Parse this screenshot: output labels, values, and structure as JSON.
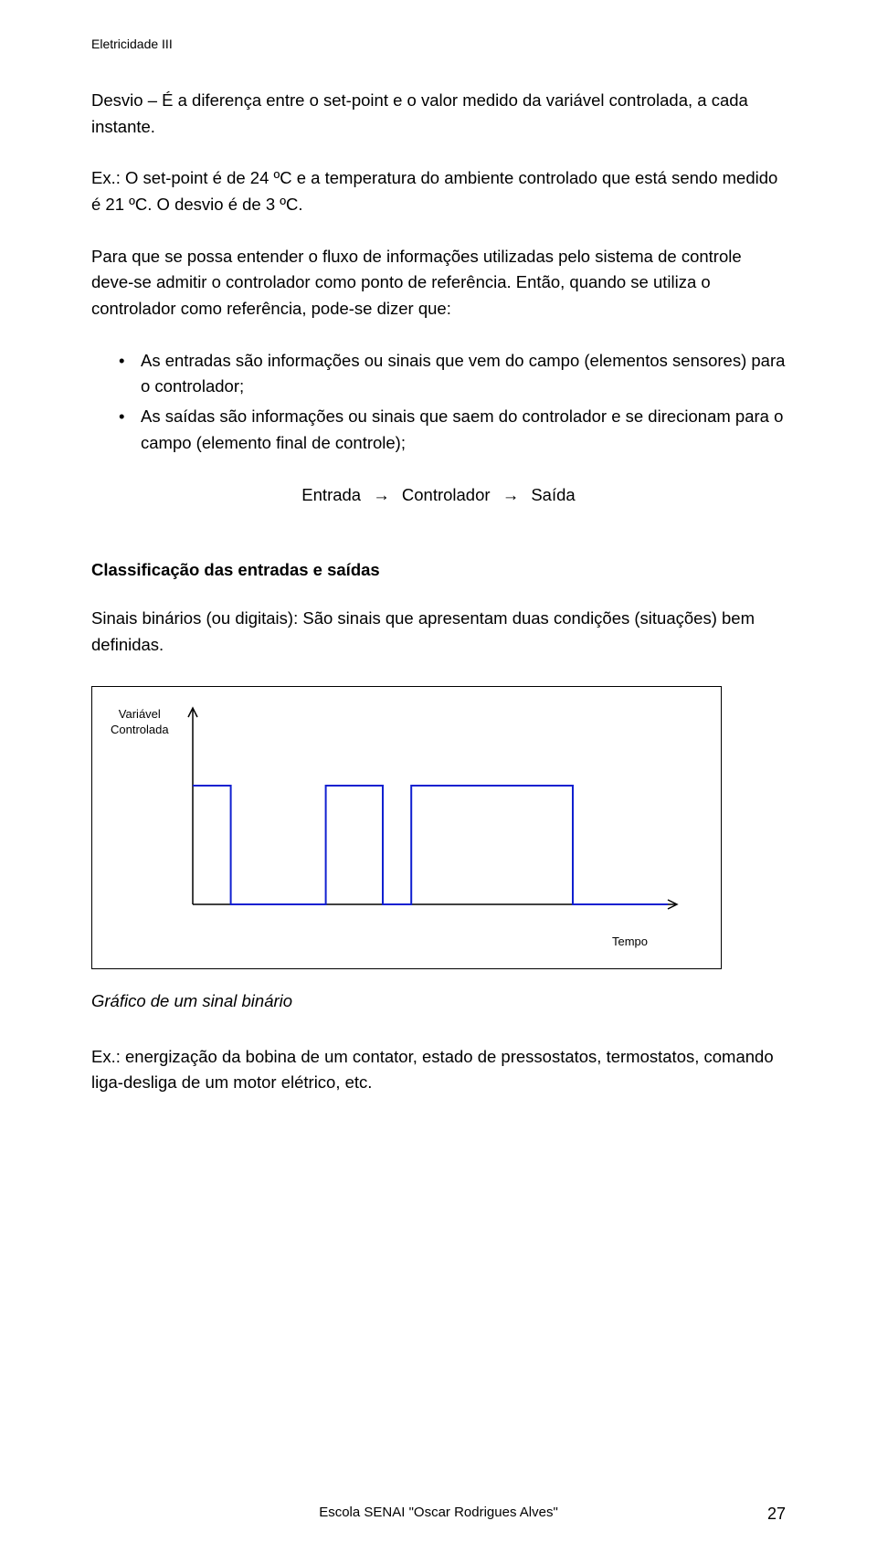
{
  "header": "Eletricidade III",
  "p1": "Desvio – É a diferença entre o set-point e o valor medido da variável controlada, a cada instante.",
  "p2": "Ex.: O set-point é de 24 ºC e a temperatura do ambiente controlado que está sendo medido é 21 ºC. O desvio é de 3 ºC.",
  "p3": "Para que se possa entender o fluxo de informações utilizadas pelo sistema de controle deve-se admitir o controlador como ponto de referência. Então, quando se utiliza o controlador como referência, pode-se dizer que:",
  "bullets": [
    "As entradas são informações ou sinais que vem do campo (elementos sensores) para o controlador;",
    "As saídas são informações ou sinais que saem do controlador e se direcionam para o campo (elemento final de controle);"
  ],
  "flow": {
    "a": "Entrada",
    "b": "Controlador",
    "c": "Saída"
  },
  "heading2": "Classificação das entradas e saídas",
  "p4": "Sinais binários (ou digitais): São sinais que apresentam duas condições (situações) bem definidas.",
  "chart_data": {
    "type": "line",
    "ylabel": "Variável Controlada",
    "xlabel": "Tempo",
    "x": [
      0,
      0.08,
      0.08,
      0.28,
      0.28,
      0.4,
      0.4,
      0.46,
      0.46,
      0.8,
      0.8,
      1.0
    ],
    "values": [
      1,
      1,
      0,
      0,
      1,
      1,
      0,
      0,
      1,
      1,
      0,
      0
    ],
    "ylim": [
      0,
      1
    ]
  },
  "caption": "Gráfico de um sinal binário",
  "p5": "Ex.: energização da bobina de um contator, estado de pressostatos, termostatos, comando liga-desliga de um motor elétrico, etc.",
  "footer": "Escola SENAI \"Oscar Rodrigues Alves\"",
  "page": "27"
}
